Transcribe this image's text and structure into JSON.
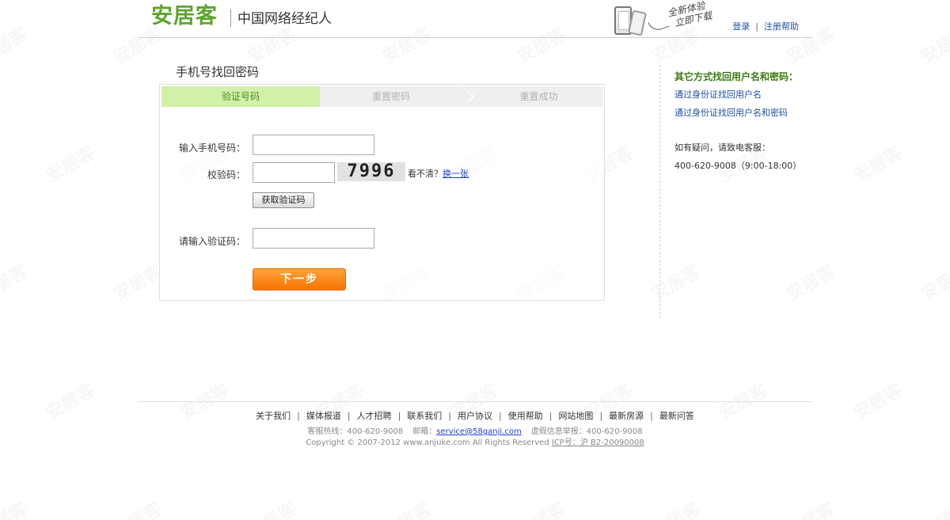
{
  "header": {
    "logo": "安居客",
    "slogan": "中国网络经纪人",
    "promo_line1": "全新体验",
    "promo_line2": "立即下载",
    "login": "登录",
    "register_help": "注册帮助",
    "separator": "|"
  },
  "page_title": "手机号找回密码",
  "steps": [
    {
      "label": "验证号码",
      "active": true
    },
    {
      "label": "重置密码",
      "active": false
    },
    {
      "label": "重置成功",
      "active": false
    }
  ],
  "form": {
    "phone_label": "输入手机号码：",
    "phone_value": "",
    "check_label": "校验码：",
    "check_value": "",
    "captcha_text": "7996",
    "cant_see": "看不清？",
    "change_one": "换一张",
    "get_code_button": "获取验证码",
    "code_label": "请输入验证码：",
    "code_value": "",
    "next_button": "下一步"
  },
  "side": {
    "title": "其它方式找回用户名和密码：",
    "link1": "通过身份证找回用户名",
    "link2": "通过身份证找回用户名和密码",
    "contact_label": "如有疑问，请致电客服：",
    "contact_phone": "400-620-9008（9:00-18:00）"
  },
  "footer": {
    "nav": [
      "关于我们",
      "媒体报道",
      "人才招聘",
      "联系我们",
      "用户协议",
      "使用帮助",
      "网站地图",
      "最新房源",
      "最新问答"
    ],
    "hotline": "客服热线：400-620-9008",
    "email_label": "邮箱：",
    "email": "service@58ganji.com",
    "report": "虚假信息举报：400-620-9008",
    "copyright": "Copyright © 2007-2012 www.anjuke.com All Rights Reserved",
    "icp": "ICP号：沪 B2-20090008"
  },
  "watermark_text": "安居客",
  "colors": {
    "brand_green": "#5aa52b",
    "active_step_bg": "#d1f0a8",
    "next_button_orange": "#f87400",
    "link_blue": "#1f4fa8"
  }
}
